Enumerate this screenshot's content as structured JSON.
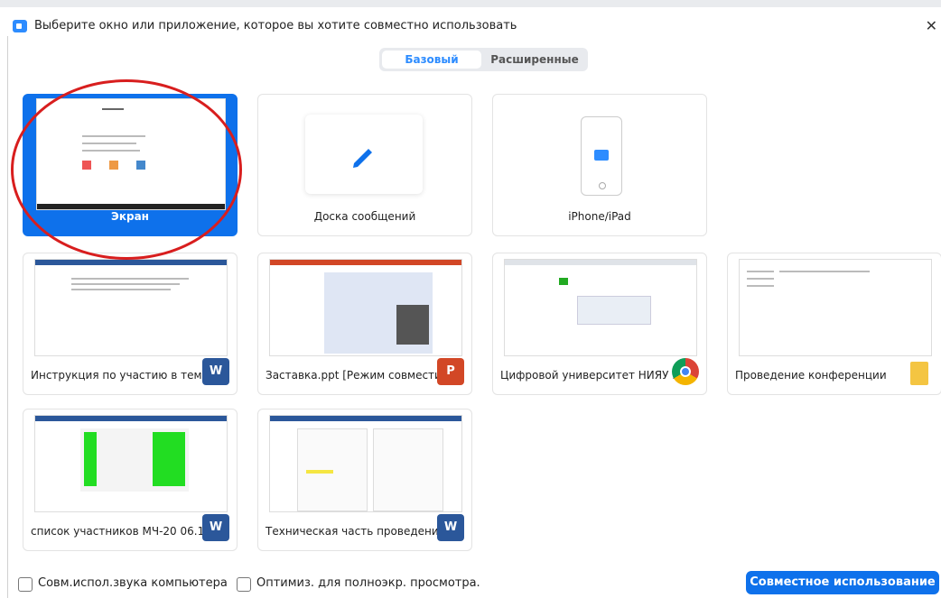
{
  "window": {
    "title": "Выберите окно или приложение, которое вы хотите совместно использовать",
    "close_glyph": "✕"
  },
  "tabs": [
    {
      "label": "Базовый",
      "active": true
    },
    {
      "label": "Расширенные",
      "active": false
    }
  ],
  "tiles": [
    {
      "label": "Экран",
      "selected": true,
      "kind": "screen"
    },
    {
      "label": "Доска сообщений",
      "selected": false,
      "kind": "whiteboard",
      "icon": "pencil-icon"
    },
    {
      "label": "iPhone/iPad",
      "selected": false,
      "kind": "device",
      "icon": "airplay-icon"
    },
    {
      "label": "Инструкция по участию в темат...",
      "app": "word",
      "badge": "W"
    },
    {
      "label": "Заставка.ppt [Режим совмести...",
      "app": "powerpoint",
      "badge": "P"
    },
    {
      "label": "Цифровой университет НИЯУ ...",
      "app": "chrome",
      "badge": ""
    },
    {
      "label": "Проведение конференции",
      "app": "folder",
      "badge": ""
    },
    {
      "label": "список участников МЧ-20 06.10...",
      "app": "word",
      "badge": "W"
    },
    {
      "label": "Техническая часть проведения ...",
      "app": "word",
      "badge": "W"
    }
  ],
  "footer": {
    "share_sound_label": "Совм.испол.звука компьютера",
    "optimize_label": "Оптимиз. для полноэкр. просмотра.",
    "share_button": "Совместное использование"
  },
  "colors": {
    "accent": "#0e71eb",
    "annotation": "#d81e1e",
    "word": "#2b579a",
    "powerpoint": "#d24726"
  }
}
